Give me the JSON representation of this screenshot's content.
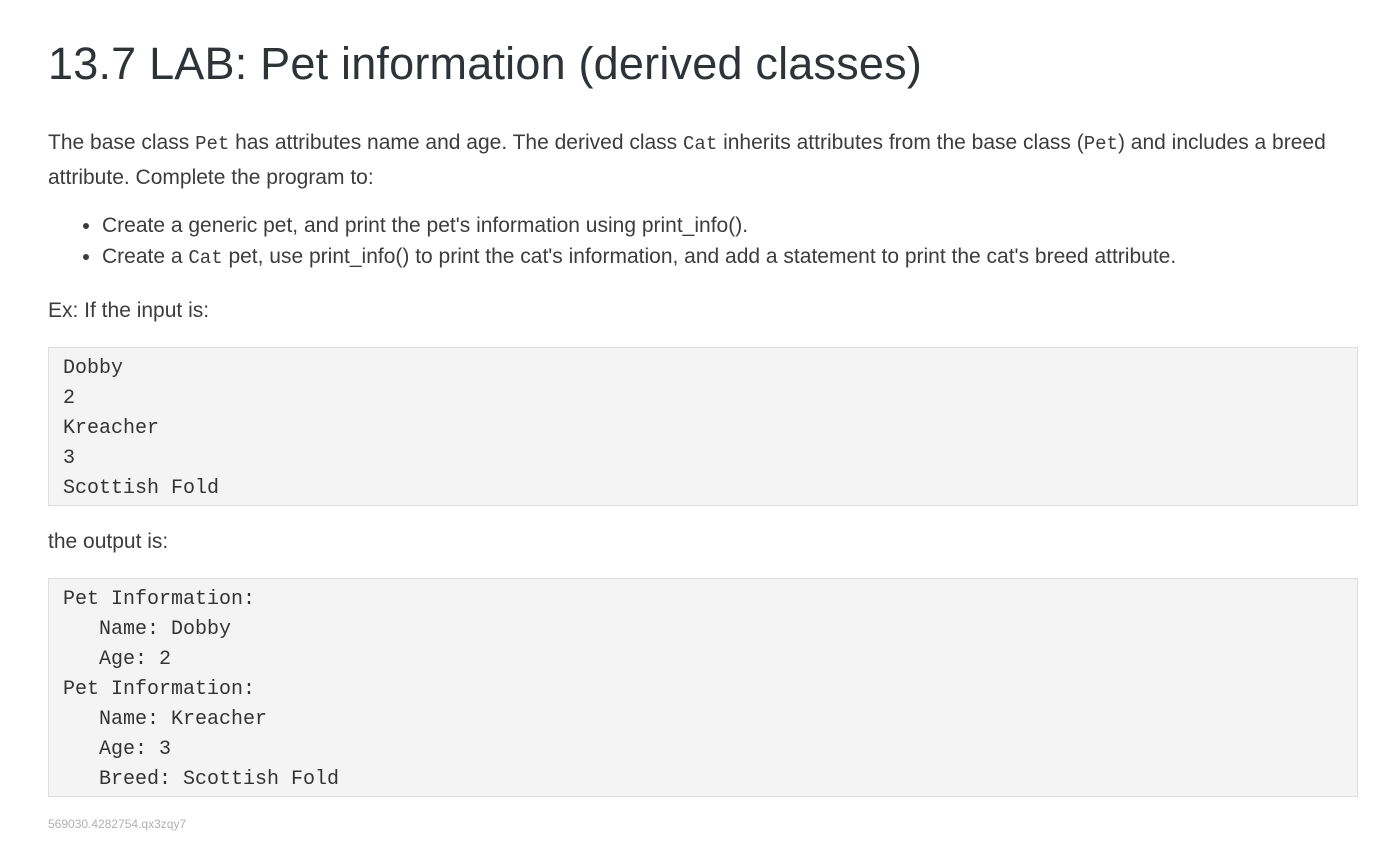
{
  "title": "13.7 LAB: Pet information (derived classes)",
  "intro": {
    "t1": "The base class ",
    "c1": "Pet",
    "t2": " has attributes name and age. The derived class ",
    "c2": "Cat",
    "t3": " inherits attributes from the base class (",
    "c3": "Pet",
    "t4": ") and includes a breed attribute. Complete the program to:"
  },
  "requirements": [
    {
      "text": "Create a generic pet, and print the pet's information using print_info()."
    },
    {
      "pre": "Create a ",
      "code": "Cat",
      "post": " pet, use print_info() to print the cat's information, and add a statement to print the cat's breed attribute."
    }
  ],
  "example_label": "Ex: If the input is:",
  "input_lines": [
    "Dobby",
    "2",
    "Kreacher",
    "3",
    "Scottish Fold"
  ],
  "output_label": "the output is:",
  "output_lines": [
    "Pet Information:",
    "   Name: Dobby",
    "   Age: 2",
    "Pet Information:",
    "   Name: Kreacher",
    "   Age: 3",
    "   Breed: Scottish Fold"
  ],
  "footer_id": "569030.4282754.qx3zqy7"
}
